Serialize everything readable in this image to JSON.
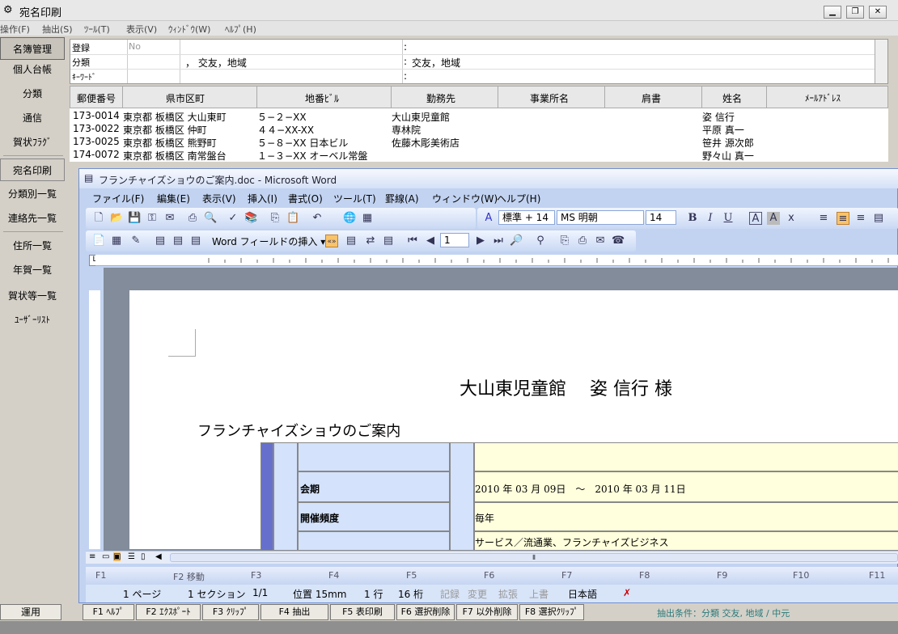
{
  "app": {
    "title": "宛名印刷",
    "menu": [
      "操作(F)",
      "抽出(S)",
      "ﾂｰﾙ(T)",
      "表示(V)",
      "ｳｨﾝﾄﾞｳ(W)",
      "ﾍﾙﾌﾟ(H)"
    ]
  },
  "sidebar": {
    "items": [
      "名簿管理",
      "個人台帳",
      "分類",
      "通信",
      "賀状ﾌﾗｸﾞ",
      "宛名印刷",
      "分類別一覧",
      "連絡先一覧",
      "住所一覧",
      "年賀一覧",
      "賀状等一覧",
      "ﾕｰｻﾞｰﾘｽﾄ"
    ],
    "bottom": "運用"
  },
  "filter": {
    "label_register": "登録",
    "label_category": "分類",
    "label_keyword": "ｷｰﾜｰﾄﾞ",
    "register_no": "No",
    "category_value": "， 交友，地域",
    "category_value2": "交友，地域",
    "colon": ":"
  },
  "list": {
    "headers": [
      "郵便番号",
      "県市区町",
      "地番ﾋﾞﾙ",
      "勤務先",
      "事業所名",
      "肩書",
      "姓名",
      "ﾒｰﾙｱﾄﾞﾚｽ"
    ],
    "rows": [
      [
        "173-0014",
        "東京都 板橋区 大山東町",
        "５−２−XX",
        "大山東児童館",
        "",
        "",
        "姿 信行",
        ""
      ],
      [
        "173-0022",
        "東京都 板橋区 仲町",
        "４４−XX-XX",
        "専林院",
        "",
        "",
        "平原 真一",
        ""
      ],
      [
        "173-0025",
        "東京都 板橋区 熊野町",
        "５−８−XX 日本ビル",
        "佐藤木彫美術店",
        "",
        "",
        "笹井 源次郎",
        ""
      ],
      [
        "174-0072",
        "東京都 板橋区 南常盤台",
        "１−３−XX オーベル常盤",
        "",
        "",
        "",
        "野々山 真一",
        ""
      ]
    ]
  },
  "word": {
    "title": "フランチャイズショウのご案内.doc - Microsoft Word",
    "menu": [
      "ファイル(F)",
      "編集(E)",
      "表示(V)",
      "挿入(I)",
      "書式(O)",
      "ツール(T)",
      "罫線(A)",
      "ウィンドウ(W)",
      "ヘルプ(H)"
    ],
    "style_combo": "標準 + 14",
    "font_combo": "MS 明朝",
    "size_combo": "14",
    "mailmerge_label": "Word フィールドの挿入 ▾",
    "record_number": "1",
    "ruler_left": "4  1  2",
    "doc": {
      "recipient": "大山東児童館　 姿 信行 様",
      "heading": "フランチャイズショウのご案内",
      "table": [
        {
          "label": "",
          "value": ""
        },
        {
          "label": "会期",
          "value": "2010 年 03 月 09日　～　2010 年 03 月 11日"
        },
        {
          "label": "開催頻度",
          "value": "毎年"
        },
        {
          "label": "",
          "value": "サービス／流通業、フランチャイズビジネス"
        }
      ]
    },
    "fkeys": [
      "F1",
      "F2 移動",
      "F3",
      "F4",
      "F5",
      "F6",
      "F7",
      "F8",
      "F9",
      "F10",
      "F11"
    ],
    "status": {
      "page": "1 ページ",
      "section": "1 セクション",
      "pages": "1/1",
      "position": "位置 15mm",
      "line": "1 行",
      "col": "16 桁",
      "rec": "記録",
      "chg": "変更",
      "ext": "拡張",
      "ovr": "上書",
      "lang": "日本語"
    }
  },
  "bottom_buttons": [
    "F1 ﾍﾙﾌﾟ",
    "F2 ｴｸｽﾎﾟｰﾄ",
    "F3 ｸﾘｯﾌﾟ",
    "F4 抽出",
    "F5 表印刷",
    "F6 選択削除",
    "F7 以外削除",
    "F8 選択ｸﾘｯﾌﾟ"
  ],
  "extract_condition": "抽出条件：分類 交友, 地域 / 中元"
}
